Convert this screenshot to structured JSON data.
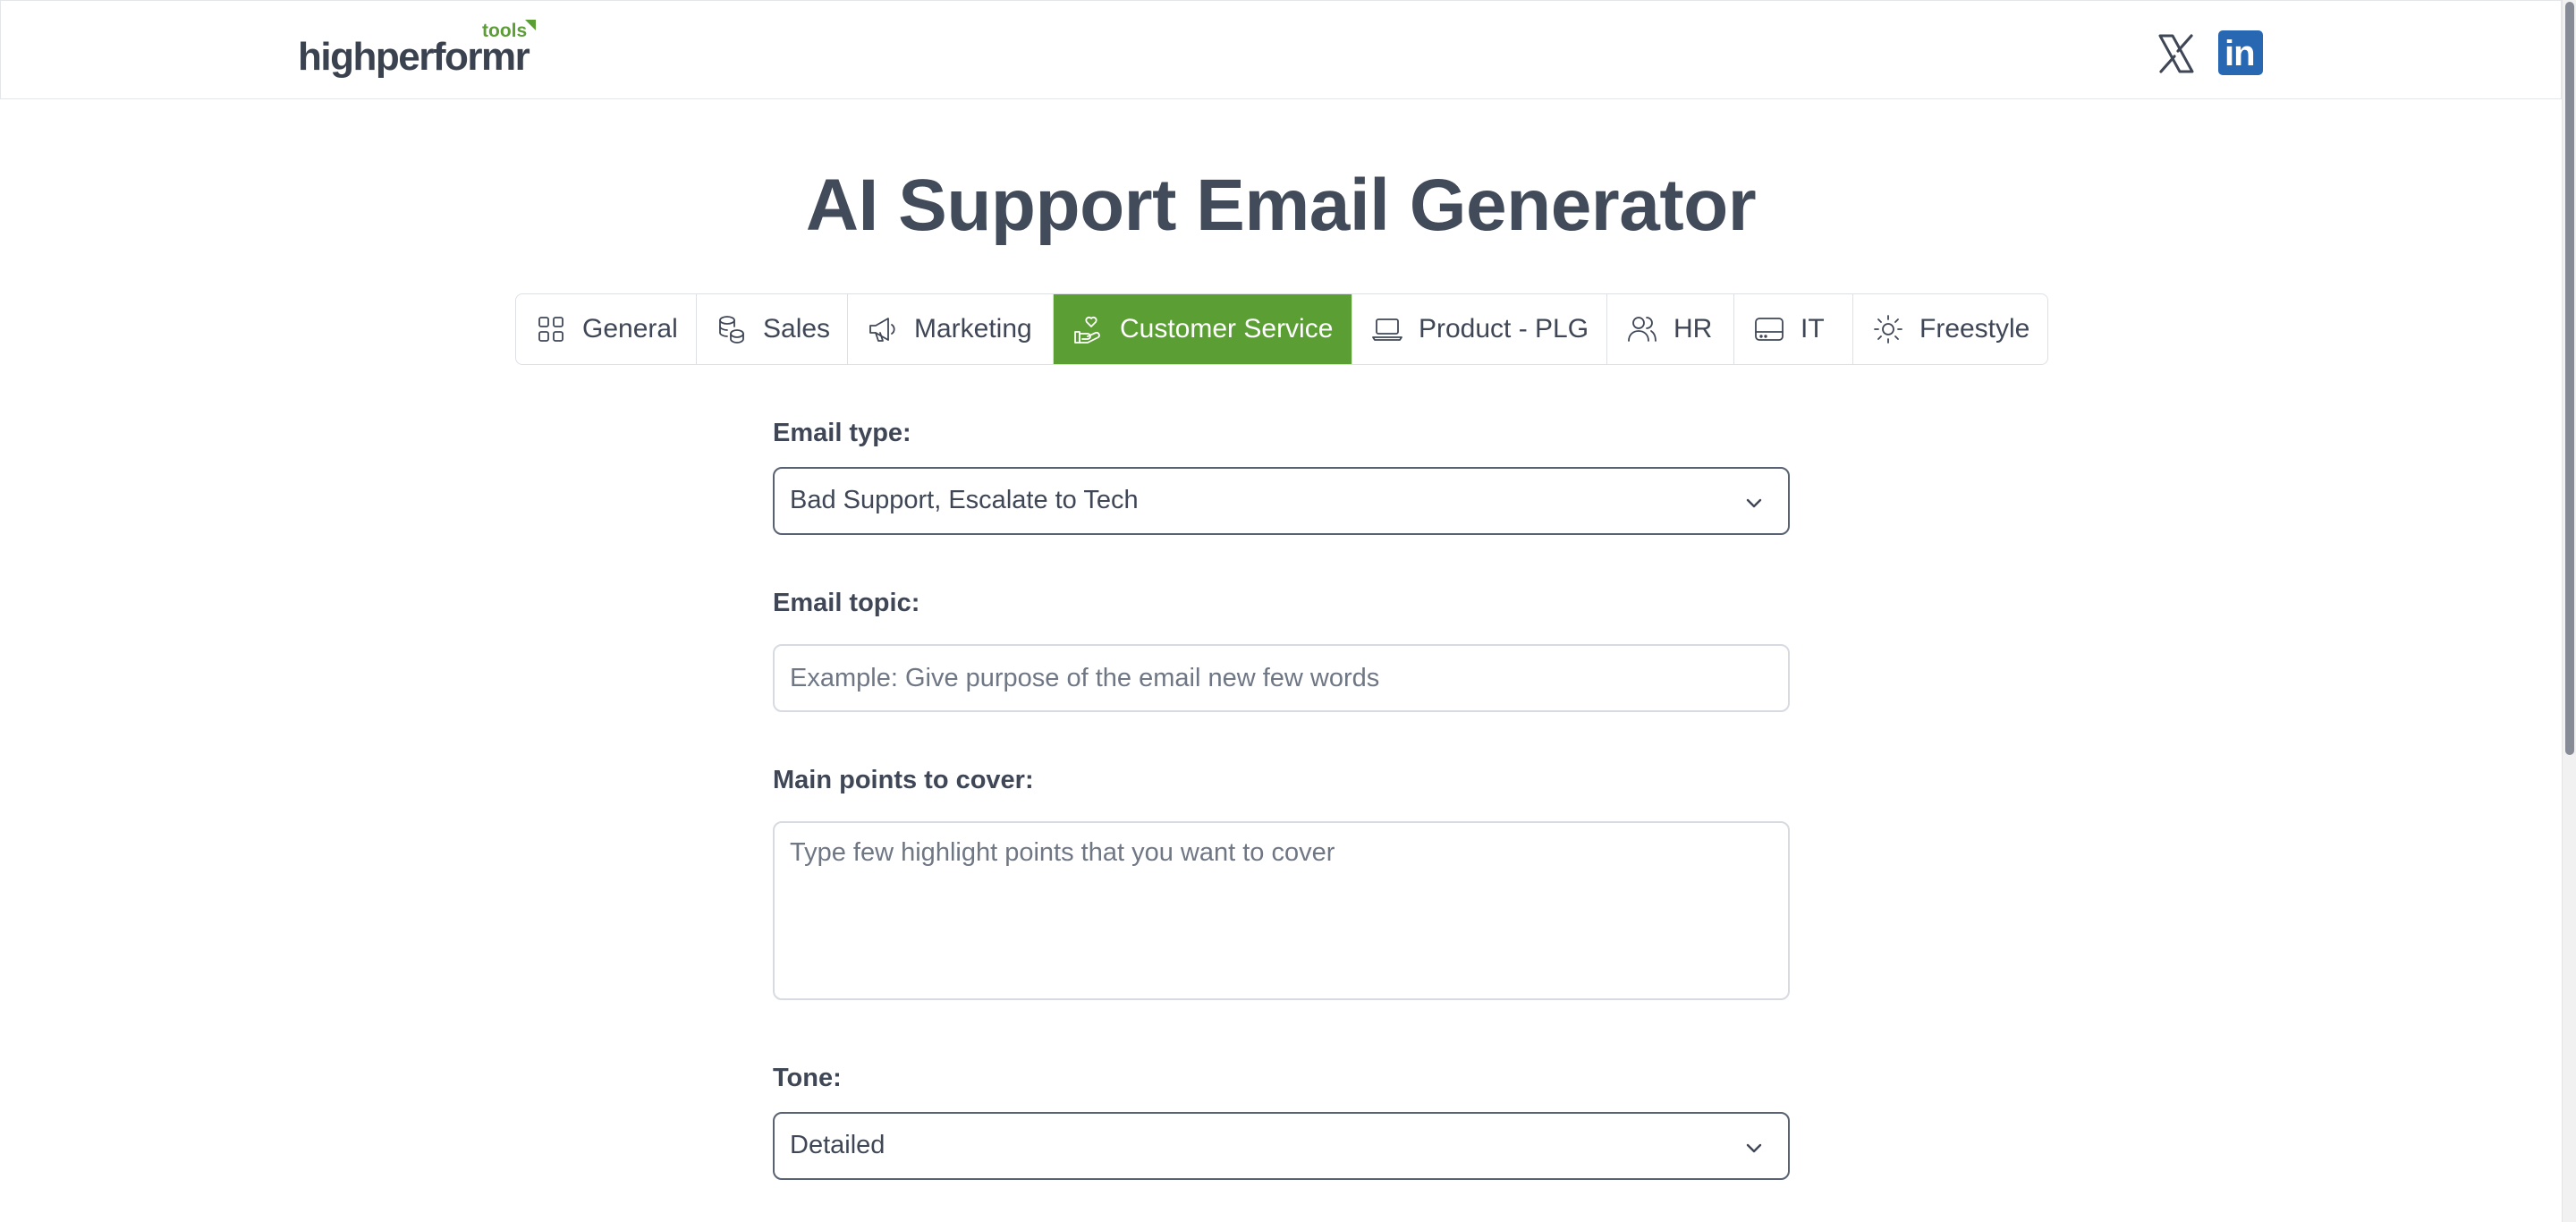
{
  "header": {
    "logo_text": "highperformr",
    "logo_tag": "tools",
    "social": [
      {
        "name": "x-icon",
        "label": "X"
      },
      {
        "name": "linkedin-icon",
        "label": "in"
      }
    ]
  },
  "page": {
    "title": "AI Support Email Generator"
  },
  "tabs": [
    {
      "label": "General",
      "icon": "grid-icon",
      "active": false
    },
    {
      "label": "Sales",
      "icon": "coins-icon",
      "active": false
    },
    {
      "label": "Marketing",
      "icon": "megaphone-icon",
      "active": false
    },
    {
      "label": "Customer Service",
      "icon": "hand-heart-icon",
      "active": true
    },
    {
      "label": "Product - PLG",
      "icon": "laptop-icon",
      "active": false
    },
    {
      "label": "HR",
      "icon": "users-icon",
      "active": false
    },
    {
      "label": "IT",
      "icon": "hard-drive-icon",
      "active": false
    },
    {
      "label": "Freestyle",
      "icon": "sun-icon",
      "active": false
    }
  ],
  "form": {
    "email_type": {
      "label": "Email type:",
      "value": "Bad Support, Escalate to Tech"
    },
    "email_topic": {
      "label": "Email topic:",
      "placeholder": "Example: Give purpose of the email new few words",
      "value": ""
    },
    "main_points": {
      "label": "Main points to cover:",
      "placeholder": "Type few highlight points that you want to cover",
      "value": ""
    },
    "tone": {
      "label": "Tone:",
      "value": "Detailed"
    }
  },
  "colors": {
    "accent": "#5b9e33",
    "text": "#424b5a",
    "linkedin": "#2867b2"
  }
}
